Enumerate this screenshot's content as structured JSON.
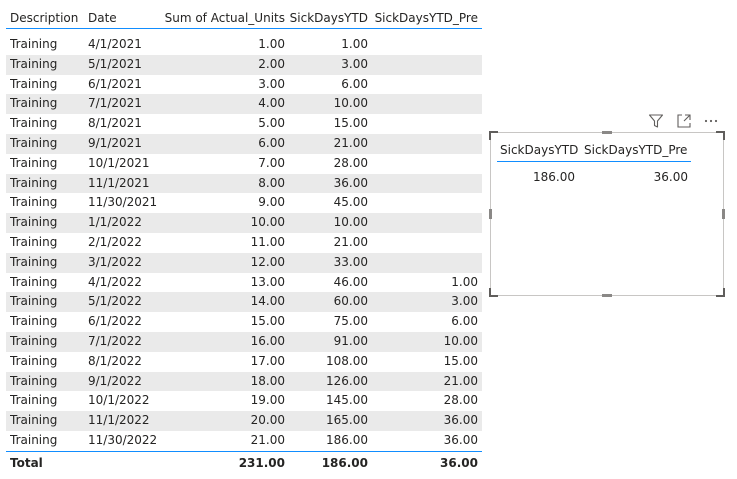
{
  "table": {
    "headers": {
      "description": "Description",
      "date": "Date",
      "units": "Sum of Actual_Units",
      "ytd": "SickDaysYTD",
      "ytd_pre": "SickDaysYTD_Pre"
    },
    "rows": [
      {
        "description": "Training",
        "date": "4/1/2021",
        "units": "1.00",
        "ytd": "1.00",
        "ytd_pre": ""
      },
      {
        "description": "Training",
        "date": "5/1/2021",
        "units": "2.00",
        "ytd": "3.00",
        "ytd_pre": ""
      },
      {
        "description": "Training",
        "date": "6/1/2021",
        "units": "3.00",
        "ytd": "6.00",
        "ytd_pre": ""
      },
      {
        "description": "Training",
        "date": "7/1/2021",
        "units": "4.00",
        "ytd": "10.00",
        "ytd_pre": ""
      },
      {
        "description": "Training",
        "date": "8/1/2021",
        "units": "5.00",
        "ytd": "15.00",
        "ytd_pre": ""
      },
      {
        "description": "Training",
        "date": "9/1/2021",
        "units": "6.00",
        "ytd": "21.00",
        "ytd_pre": ""
      },
      {
        "description": "Training",
        "date": "10/1/2021",
        "units": "7.00",
        "ytd": "28.00",
        "ytd_pre": ""
      },
      {
        "description": "Training",
        "date": "11/1/2021",
        "units": "8.00",
        "ytd": "36.00",
        "ytd_pre": ""
      },
      {
        "description": "Training",
        "date": "11/30/2021",
        "units": "9.00",
        "ytd": "45.00",
        "ytd_pre": ""
      },
      {
        "description": "Training",
        "date": "1/1/2022",
        "units": "10.00",
        "ytd": "10.00",
        "ytd_pre": ""
      },
      {
        "description": "Training",
        "date": "2/1/2022",
        "units": "11.00",
        "ytd": "21.00",
        "ytd_pre": ""
      },
      {
        "description": "Training",
        "date": "3/1/2022",
        "units": "12.00",
        "ytd": "33.00",
        "ytd_pre": ""
      },
      {
        "description": "Training",
        "date": "4/1/2022",
        "units": "13.00",
        "ytd": "46.00",
        "ytd_pre": "1.00"
      },
      {
        "description": "Training",
        "date": "5/1/2022",
        "units": "14.00",
        "ytd": "60.00",
        "ytd_pre": "3.00"
      },
      {
        "description": "Training",
        "date": "6/1/2022",
        "units": "15.00",
        "ytd": "75.00",
        "ytd_pre": "6.00"
      },
      {
        "description": "Training",
        "date": "7/1/2022",
        "units": "16.00",
        "ytd": "91.00",
        "ytd_pre": "10.00"
      },
      {
        "description": "Training",
        "date": "8/1/2022",
        "units": "17.00",
        "ytd": "108.00",
        "ytd_pre": "15.00"
      },
      {
        "description": "Training",
        "date": "9/1/2022",
        "units": "18.00",
        "ytd": "126.00",
        "ytd_pre": "21.00"
      },
      {
        "description": "Training",
        "date": "10/1/2022",
        "units": "19.00",
        "ytd": "145.00",
        "ytd_pre": "28.00"
      },
      {
        "description": "Training",
        "date": "11/1/2022",
        "units": "20.00",
        "ytd": "165.00",
        "ytd_pre": "36.00"
      },
      {
        "description": "Training",
        "date": "11/30/2022",
        "units": "21.00",
        "ytd": "186.00",
        "ytd_pre": "36.00"
      }
    ],
    "total": {
      "label": "Total",
      "units": "231.00",
      "ytd": "186.00",
      "ytd_pre": "36.00"
    }
  },
  "card": {
    "headers": {
      "ytd": "SickDaysYTD",
      "ytd_pre": "SickDaysYTD_Pre"
    },
    "values": {
      "ytd": "186.00",
      "ytd_pre": "36.00"
    }
  },
  "visual_header": {
    "icons": [
      "filter-icon",
      "focus-mode-icon",
      "more-options-icon"
    ]
  },
  "colors": {
    "accent": "#118dff",
    "stripe": "#eaeaea",
    "text": "#252423",
    "icon": "#605e5c"
  }
}
